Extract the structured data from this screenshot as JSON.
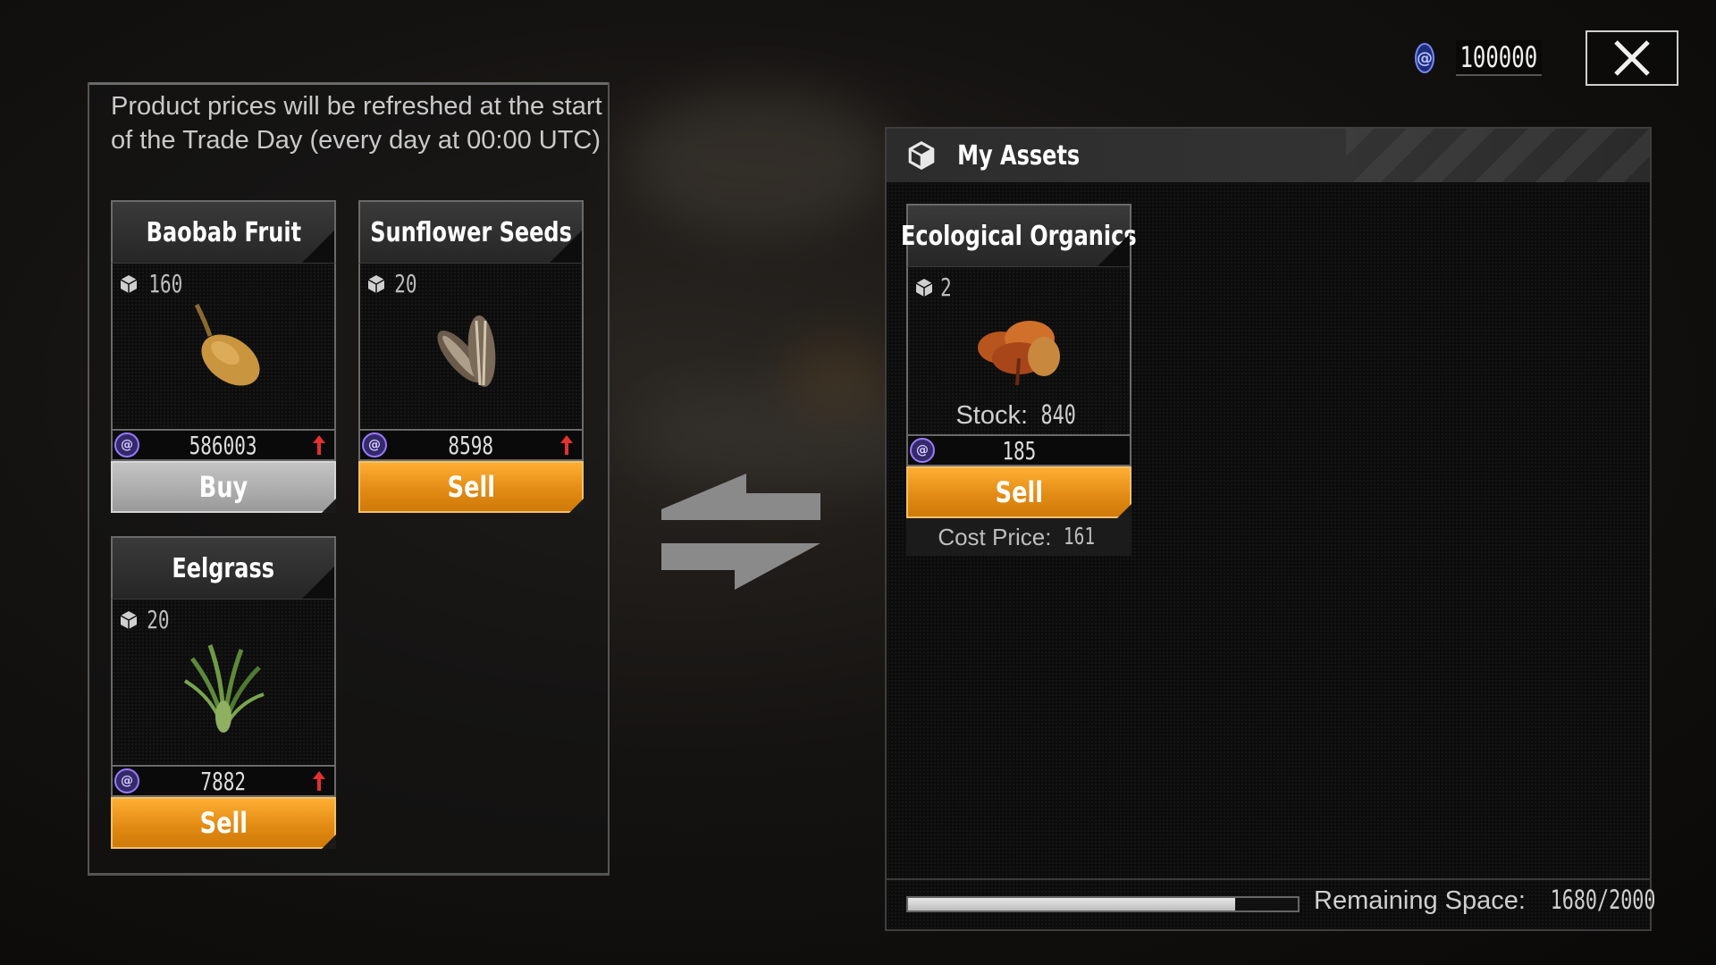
{
  "currency": {
    "icon": "coin-icon",
    "amount": "100000"
  },
  "close": {
    "icon": "close-icon"
  },
  "notice": "Product prices will be refreshed at the start of the Trade Day (every day at 00:00 UTC)",
  "market": {
    "items": [
      {
        "name": "Baobab Fruit",
        "qty": "160",
        "price": "586003",
        "trend": "up",
        "action": "Buy"
      },
      {
        "name": "Sunflower Seeds",
        "qty": "20",
        "price": "8598",
        "trend": "up",
        "action": "Sell"
      },
      {
        "name": "Eelgrass",
        "qty": "20",
        "price": "7882",
        "trend": "up",
        "action": "Sell"
      }
    ]
  },
  "assets": {
    "title": "My Assets",
    "item": {
      "name": "Ecological Organics",
      "qty": "2",
      "stock_label": "Stock:",
      "stock": "840",
      "price": "185",
      "action": "Sell",
      "cost_label": "Cost Price:",
      "cost": "161"
    },
    "space": {
      "label": "Remaining Space:",
      "value": "1680/2000",
      "fill_fraction": 0.84
    }
  },
  "colors": {
    "sell": "#e08912",
    "buy": "#9a9a9a",
    "trend_up": "#e53030",
    "coin": "#7a86ff"
  }
}
